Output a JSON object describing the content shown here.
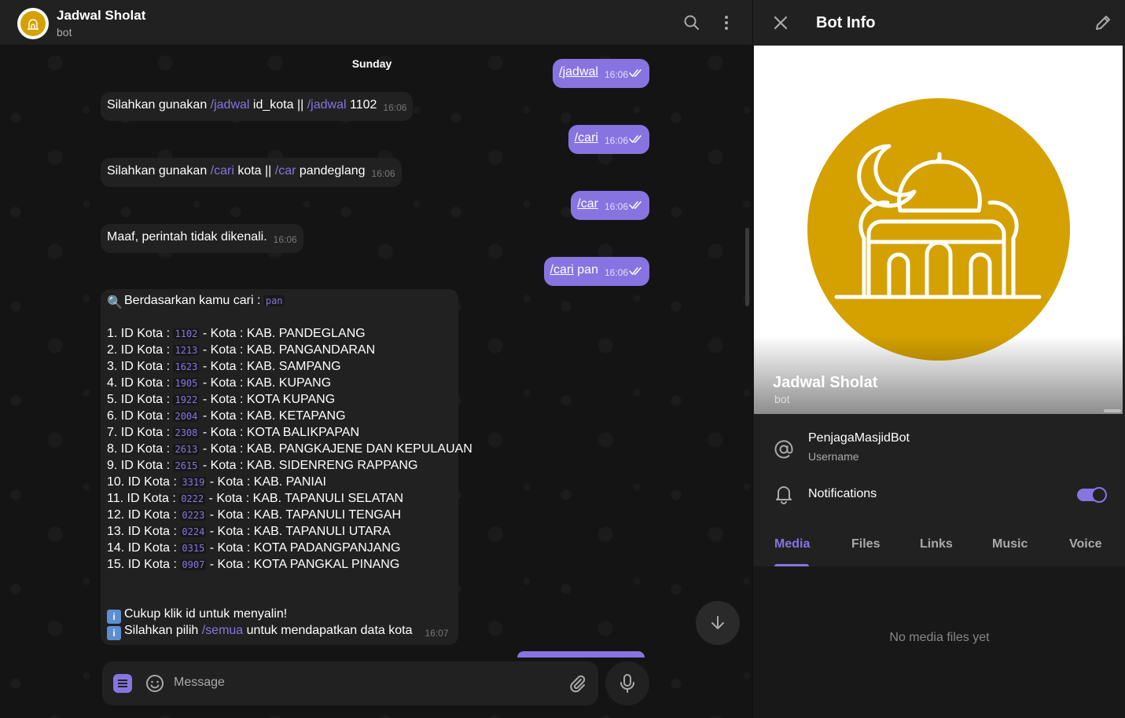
{
  "header": {
    "title": "Jadwal Sholat",
    "subtitle": "bot",
    "search_icon": "search-icon",
    "more_icon": "more-vertical-icon"
  },
  "chat": {
    "day_label": "Sunday",
    "messages": [
      {
        "dir": "out",
        "parts": [
          {
            "t": "/jadwal",
            "cmd": true
          }
        ],
        "time": "16:06"
      },
      {
        "dir": "in",
        "parts": [
          {
            "t": "Silahkan gunakan "
          },
          {
            "t": "/jadwal",
            "cmd": true
          },
          {
            "t": " id_kota || "
          },
          {
            "t": "/jadwal",
            "cmd": true
          },
          {
            "t": " 1102"
          }
        ],
        "time": "16:06"
      },
      {
        "dir": "out",
        "parts": [
          {
            "t": "/cari",
            "cmd": true
          }
        ],
        "time": "16:06"
      },
      {
        "dir": "in",
        "parts": [
          {
            "t": "Silahkan gunakan "
          },
          {
            "t": "/cari",
            "cmd": true
          },
          {
            "t": " kota || "
          },
          {
            "t": "/car",
            "cmd": true
          },
          {
            "t": " pandeglang"
          }
        ],
        "time": "16:06"
      },
      {
        "dir": "out",
        "parts": [
          {
            "t": "/car",
            "cmd": true
          }
        ],
        "time": "16:06"
      },
      {
        "dir": "in",
        "parts": [
          {
            "t": "Maaf, perintah tidak dikenali."
          }
        ],
        "time": "16:06"
      },
      {
        "dir": "out",
        "parts": [
          {
            "t": "/cari",
            "cmd": true
          },
          {
            "t": " pan"
          }
        ],
        "time": "16:06"
      }
    ],
    "search_result": {
      "intro": "Berdasarkan kamu cari : ",
      "query": "pan",
      "rows": [
        {
          "n": "1.",
          "id": "1102",
          "kota": "KAB. PANDEGLANG"
        },
        {
          "n": "2.",
          "id": "1213",
          "kota": "KAB. PANGANDARAN"
        },
        {
          "n": "3.",
          "id": "1623",
          "kota": "KAB. SAMPANG"
        },
        {
          "n": "4.",
          "id": "1905",
          "kota": "KAB. KUPANG"
        },
        {
          "n": "5.",
          "id": "1922",
          "kota": "KOTA KUPANG"
        },
        {
          "n": "6.",
          "id": "2004",
          "kota": "KAB. KETAPANG"
        },
        {
          "n": "7.",
          "id": "2308",
          "kota": "KOTA BALIKPAPAN"
        },
        {
          "n": "8.",
          "id": "2613",
          "kota": "KAB. PANGKAJENE DAN KEPULAUAN"
        },
        {
          "n": "9.",
          "id": "2615",
          "kota": "KAB. SIDENRENG RAPPANG"
        },
        {
          "n": "10.",
          "id": "3319",
          "kota": "KAB. PANIAI"
        },
        {
          "n": "11.",
          "id": "0222",
          "kota": "KAB. TAPANULI SELATAN"
        },
        {
          "n": "12.",
          "id": "0223",
          "kota": "KAB. TAPANULI TENGAH"
        },
        {
          "n": "13.",
          "id": "0224",
          "kota": "KAB. TAPANULI UTARA"
        },
        {
          "n": "14.",
          "id": "0315",
          "kota": "KOTA PADANGPANJANG"
        },
        {
          "n": "15.",
          "id": "0907",
          "kota": "KOTA PANGKAL PINANG"
        }
      ],
      "id_label": " ID Kota : ",
      "kota_label": " - Kota : ",
      "note1": "Cukup klik id untuk menyalin!",
      "note2_pre": "Silahkan pilih ",
      "note2_cmd": "/semua",
      "note2_post": " untuk mendapatkan data kota",
      "time": "16:07"
    }
  },
  "composer": {
    "placeholder": "Message"
  },
  "panel": {
    "title": "Bot Info",
    "name": "Jadwal Sholat",
    "subtitle": "bot",
    "username": "PenjagaMasjidBot",
    "username_label": "Username",
    "notifications_label": "Notifications",
    "notifications_on": true,
    "tabs": [
      "Media",
      "Files",
      "Links",
      "Music",
      "Voice"
    ],
    "active_tab": "Media",
    "empty_text": "No media files yet"
  },
  "colors": {
    "accent": "#8774e1",
    "avatar_gold": "#d4a100",
    "bubble_in": "#212121",
    "panel_bg": "#212121"
  }
}
